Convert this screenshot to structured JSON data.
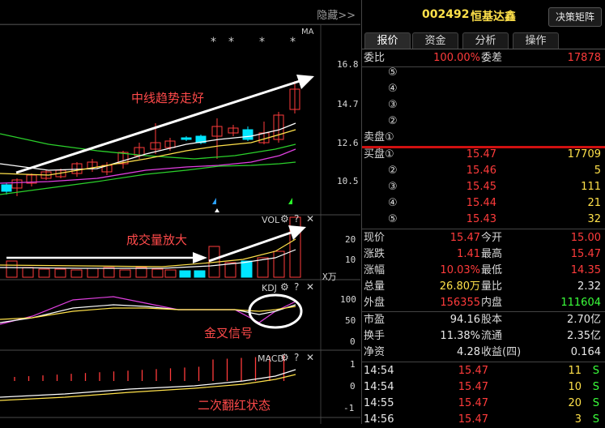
{
  "toolbar": {
    "hide_label": "隐藏>>"
  },
  "price_axis": [
    "16.8",
    "14.7",
    "12.6",
    "10.5"
  ],
  "ma_label": "MA",
  "annotations": {
    "trend": "中线趋势走好",
    "volume": "成交量放大",
    "kdj": "金叉信号",
    "macd": "二次翻红状态"
  },
  "panels": {
    "vol": {
      "title": "VOL",
      "axis": [
        "20",
        "10"
      ],
      "unit": "X万"
    },
    "kdj": {
      "title": "KDJ",
      "axis": [
        "100",
        "50",
        "0"
      ]
    },
    "macd": {
      "title": "MACD",
      "axis": [
        "1",
        "0",
        "-1"
      ]
    }
  },
  "stock": {
    "code": "002492",
    "name": "恒基达鑫",
    "matrix_button": "决策矩阵"
  },
  "tabs": [
    "报价",
    "资金",
    "分析",
    "操作"
  ],
  "order_ratio": {
    "label1": "委比",
    "value1": "100.00%",
    "label2": "委差",
    "value2": "17878"
  },
  "sell": {
    "levels": [
      "⑤",
      "④",
      "③",
      "②"
    ],
    "last_label": "卖盘①"
  },
  "buy": [
    {
      "label": "买盘①",
      "price": "15.47",
      "vol": "17709"
    },
    {
      "label": "②",
      "price": "15.46",
      "vol": "5"
    },
    {
      "label": "③",
      "price": "15.45",
      "vol": "111"
    },
    {
      "label": "④",
      "price": "15.44",
      "vol": "21"
    },
    {
      "label": "⑤",
      "price": "15.43",
      "vol": "32"
    }
  ],
  "quote": [
    {
      "l1": "现价",
      "v1": "15.47",
      "l2": "今开",
      "v2": "15.00"
    },
    {
      "l1": "涨跌",
      "v1": "1.41",
      "l2": "最高",
      "v2": "15.47"
    },
    {
      "l1": "涨幅",
      "v1": "10.03%",
      "l2": "最低",
      "v2": "14.35"
    },
    {
      "l1": "总量",
      "v1": "26.80万",
      "l2": "量比",
      "v2": "2.32"
    },
    {
      "l1": "外盘",
      "v1": "156355",
      "l2": "内盘",
      "v2": "111604"
    }
  ],
  "fundamentals": [
    {
      "l1": "市盈",
      "v1": "94.16",
      "l2": "股本",
      "v2": "2.70亿"
    },
    {
      "l1": "换手",
      "v1": "11.38%",
      "l2": "流通",
      "v2": "2.35亿"
    },
    {
      "l1": "净资",
      "v1": "4.28",
      "l2": "收益(四)",
      "v2": "0.164"
    }
  ],
  "trades": [
    {
      "time": "14:54",
      "price": "15.47",
      "vol": "11",
      "side": "S"
    },
    {
      "time": "14:54",
      "price": "15.47",
      "vol": "10",
      "side": "S"
    },
    {
      "time": "14:55",
      "price": "15.47",
      "vol": "20",
      "side": "S"
    },
    {
      "time": "14:56",
      "price": "15.47",
      "vol": "3",
      "side": "S"
    }
  ],
  "colors": {
    "up": "#ff3b3b",
    "down": "#00e5ff",
    "accent": "#ffe14a"
  }
}
